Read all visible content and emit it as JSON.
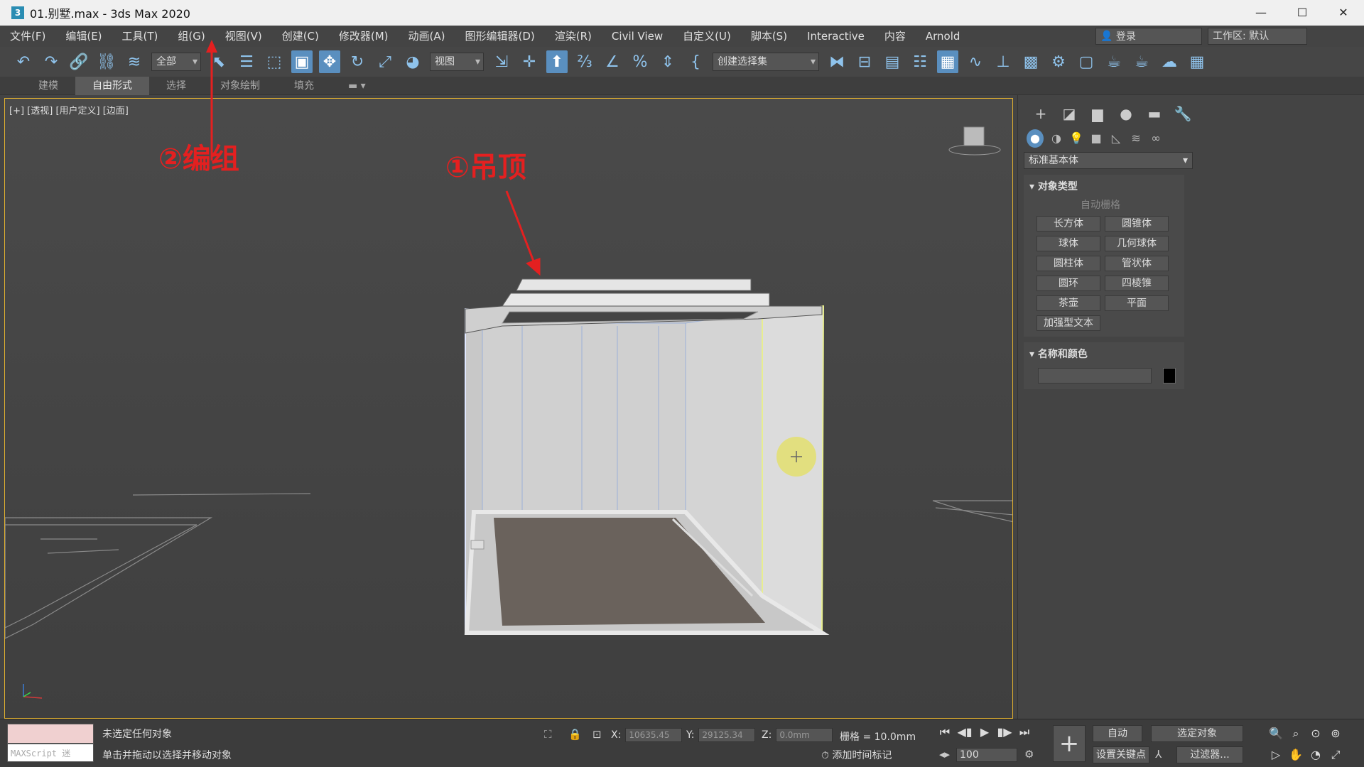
{
  "window": {
    "title": "01.别墅.max - 3ds Max 2020",
    "app_icon": "3",
    "minimize": "—",
    "maximize": "☐",
    "close": "✕"
  },
  "menu": {
    "items": [
      "文件(F)",
      "编辑(E)",
      "工具(T)",
      "组(G)",
      "视图(V)",
      "创建(C)",
      "修改器(M)",
      "动画(A)",
      "图形编辑器(D)",
      "渲染(R)",
      "Civil View",
      "自定义(U)",
      "脚本(S)",
      "Interactive",
      "内容",
      "Arnold"
    ],
    "login": "登录",
    "workspace": "工作区: 默认"
  },
  "toolbar": {
    "filter_select": "全部",
    "coord_select": "视图",
    "selection_set": "创建选择集"
  },
  "ribbon": {
    "tabs": [
      "建模",
      "自由形式",
      "选择",
      "对象绘制",
      "填充"
    ]
  },
  "viewport": {
    "label": "[+] [透视] [用户定义] [边面]"
  },
  "annotations": {
    "group": "②编组",
    "ceiling": "①吊顶"
  },
  "command_panel": {
    "category": "标准基本体",
    "object_type_title": "对象类型",
    "autogrid": "自动栅格",
    "buttons": [
      "长方体",
      "圆锥体",
      "球体",
      "几何球体",
      "圆柱体",
      "管状体",
      "圆环",
      "四棱锥",
      "茶壶",
      "平面",
      "加强型文本"
    ],
    "name_color_title": "名称和颜色",
    "object_color": "#000000"
  },
  "status": {
    "maxscript": "MAXScript 迷",
    "line1": "未选定任何对象",
    "line2": "单击并拖动以选择并移动对象",
    "x_label": "X:",
    "x_value": "10635.45",
    "y_label": "Y:",
    "y_value": "29125.34",
    "z_label": "Z:",
    "z_value": "0.0mm",
    "grid": "栅格 = 10.0mm",
    "add_time_tag": "添加时间标记",
    "frame": "100",
    "auto": "自动",
    "selected_object": "选定对象",
    "set_key": "设置关键点",
    "filters": "过滤器..."
  },
  "colors": {
    "accent": "#5a8fbf",
    "annotation": "#e42020",
    "viewport_border": "#e0b030"
  }
}
